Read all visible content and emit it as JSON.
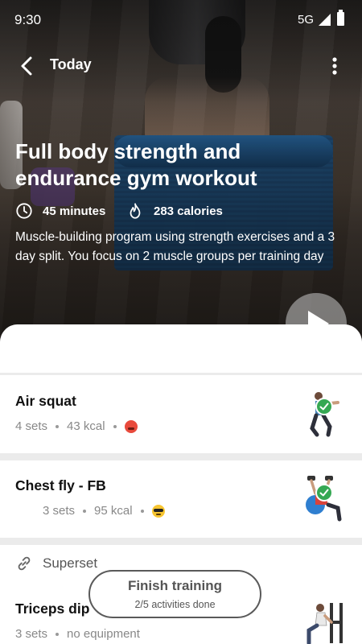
{
  "status_bar": {
    "time": "9:30",
    "network": "5G"
  },
  "header": {
    "title": "Today"
  },
  "workout": {
    "title": "Full body strength and endurance gym workout",
    "duration": "45 minutes",
    "calories": "283 calories",
    "description": "Muscle-building program using strength exercises and a 3 day split. You focus on 2 muscle groups per training day"
  },
  "exercises": [
    {
      "name": "Air squat",
      "sets": "4 sets",
      "detail": "43 kcal",
      "emoji": "hot-face",
      "completed": true
    },
    {
      "name": "Chest fly - FB",
      "sets": "3 sets",
      "detail": "95 kcal",
      "emoji": "cool-face",
      "completed": true
    },
    {
      "name": "Triceps dip",
      "sets": "3 sets",
      "detail": "no equipment",
      "completed": false
    }
  ],
  "superset": {
    "label": "Superset"
  },
  "finish": {
    "label": "Finish training",
    "progress": "2/5 activities done"
  },
  "colors": {
    "check": "#35a853",
    "mat": "#1e4c7a"
  }
}
